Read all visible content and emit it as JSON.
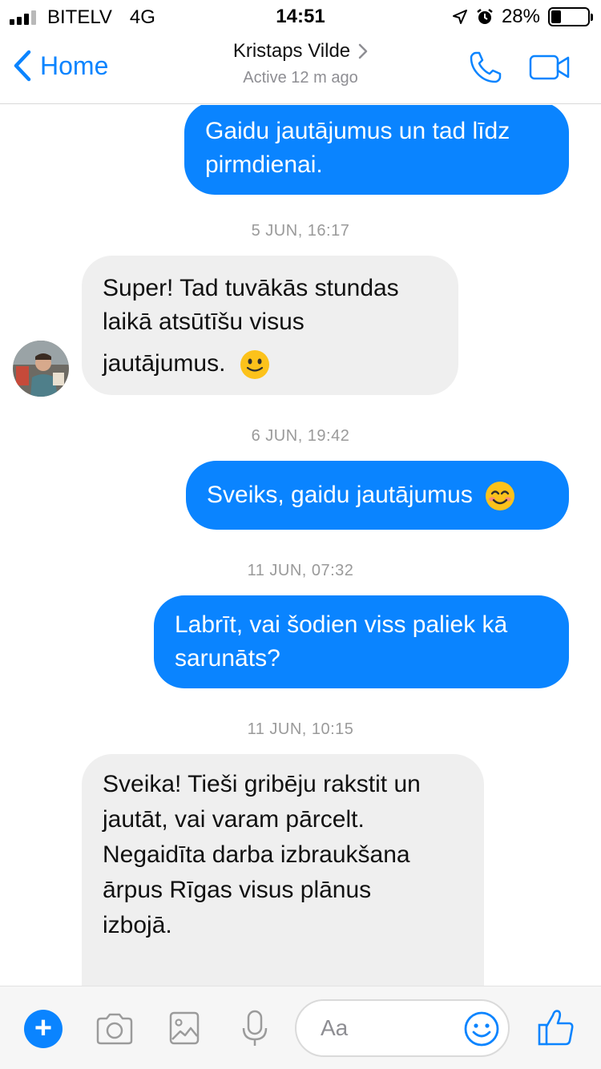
{
  "status_bar": {
    "carrier": "BITELV",
    "network": "4G",
    "time": "14:51",
    "battery_percent": "28%",
    "battery_level": 0.28,
    "signal_bars_active": 3,
    "signal_bars_total": 4
  },
  "header": {
    "back_label": "Home",
    "contact_name": "Kristaps Vilde",
    "contact_status": "Active 12 m ago",
    "accent_color": "#0a84ff"
  },
  "messages": [
    {
      "type": "out",
      "text_lines": [
        "Gaidu jautājumus un tad līdz",
        "pirmdienai."
      ]
    },
    {
      "type": "timestamp",
      "text": "5 JUN, 16:17"
    },
    {
      "type": "in",
      "text_lines": [
        "Super! Tad tuvākās stundas",
        "laikā atsūtīšu visus",
        "jautājumus."
      ],
      "emoji": "slightly-smiling-face"
    },
    {
      "type": "timestamp",
      "text": "6 JUN, 19:42"
    },
    {
      "type": "out",
      "text": "Sveiks, gaidu jautājumus",
      "emoji": "smiling-face-with-smiling-eyes"
    },
    {
      "type": "timestamp",
      "text": "11 JUN, 07:32"
    },
    {
      "type": "out",
      "text_lines": [
        "Labrīt, vai šodien viss paliek kā",
        "sarunāts?"
      ]
    },
    {
      "type": "timestamp",
      "text": "11 JUN, 10:15"
    },
    {
      "type": "in",
      "text_lines": [
        "Sveika! Tieši gribēju rakstit un",
        "jautāt, vai varam pārcelt.",
        "Negaidīta darba izbraukšana",
        "ārpus Rīgas visus plānus",
        "izbojā."
      ]
    }
  ],
  "composer": {
    "placeholder": "Aa"
  }
}
